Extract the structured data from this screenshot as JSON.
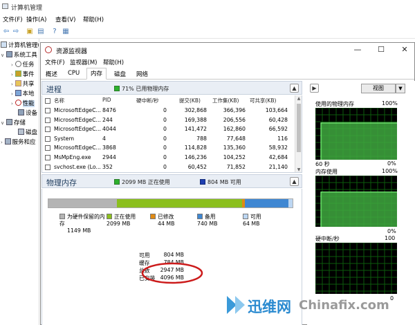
{
  "cm_window": {
    "title": "计算机管理",
    "menu": [
      "文件(F)",
      "操作(A)",
      "查看(V)",
      "帮助(H)"
    ],
    "tree": [
      {
        "label": "计算机管理(",
        "indent": 0
      },
      {
        "label": "系统工具",
        "indent": 1
      },
      {
        "label": "任务",
        "indent": 2
      },
      {
        "label": "事件",
        "indent": 2
      },
      {
        "label": "共享",
        "indent": 2
      },
      {
        "label": "本地",
        "indent": 2
      },
      {
        "label": "性能",
        "indent": 2
      },
      {
        "label": "设备",
        "indent": 2
      },
      {
        "label": "存储",
        "indent": 1
      },
      {
        "label": "磁盘",
        "indent": 2
      },
      {
        "label": "服务和应",
        "indent": 1
      }
    ]
  },
  "rm_window": {
    "title": "资源监视器",
    "menu": [
      "文件(F)",
      "监视器(M)",
      "帮助(H)"
    ],
    "tabs": [
      "概述",
      "CPU",
      "内存",
      "磁盘",
      "网络"
    ],
    "active_tab": "内存",
    "controls": {
      "minimize": "—",
      "maximize": "☐",
      "close": "✕"
    }
  },
  "processes": {
    "title": "进程",
    "status": "71% 已用物理内存",
    "status_color": "#2db02d",
    "columns": [
      "名称",
      "PID",
      "硬中断/秒",
      "提交(KB)",
      "工作集(KB)",
      "可共享(KB)"
    ],
    "rows": [
      [
        "MicrosoftEdgeC...",
        "8476",
        "0",
        "302,868",
        "366,396",
        "103,664"
      ],
      [
        "MicrosoftEdgeC...",
        "244",
        "0",
        "169,388",
        "206,556",
        "60,428"
      ],
      [
        "MicrosoftEdgeC...",
        "4044",
        "0",
        "141,472",
        "162,860",
        "66,592"
      ],
      [
        "System",
        "4",
        "0",
        "788",
        "77,648",
        "116"
      ],
      [
        "MicrosoftEdgeC...",
        "3868",
        "0",
        "114,828",
        "135,360",
        "58,932"
      ],
      [
        "MsMpEng.exe",
        "2944",
        "0",
        "146,236",
        "104,252",
        "42,684"
      ],
      [
        "svchost.exe (Lo...",
        "352",
        "0",
        "60,452",
        "71,852",
        "21,140"
      ]
    ]
  },
  "physical_memory": {
    "title": "物理内存",
    "in_use_label": "2099 MB 正在使用",
    "in_use_color": "#2db02d",
    "available_label": "804 MB 可用",
    "available_color": "#1f3fb0",
    "bar_fractions": {
      "reserved": 0.2805,
      "in_use": 0.5125,
      "modified": 0.0107,
      "standby": 0.1807,
      "free": 0.0156
    },
    "legend": [
      {
        "name": "为硬件保留的内存",
        "value": "1149 MB",
        "color": "#b4b4b4"
      },
      {
        "name": "正在使用",
        "value": "2099 MB",
        "color": "#8bbf1e"
      },
      {
        "name": "已修改",
        "value": "44 MB",
        "color": "#e08a14"
      },
      {
        "name": "备用",
        "value": "740 MB",
        "color": "#3f87d2"
      },
      {
        "name": "可用",
        "value": "64 MB",
        "color": "#bcd6f2"
      }
    ],
    "summary": [
      {
        "k": "可用",
        "v": "804 MB"
      },
      {
        "k": "缓存",
        "v": "784 MB"
      },
      {
        "k": "总数",
        "v": "2947 MB"
      },
      {
        "k": "已安装",
        "v": "4096 MB"
      }
    ],
    "highlight_color": "#cc1b1b"
  },
  "right_panel": {
    "view_label": "视图",
    "graphs": [
      {
        "title": "使用的物理内存",
        "top_value": "100%",
        "bottom_left": "60 秒",
        "bottom_right": "0%",
        "level": 0.71
      },
      {
        "title": "内存使用",
        "top_value": "100%",
        "bottom_left": "",
        "bottom_right": "0%",
        "level": 0.68
      },
      {
        "title": "硬中断/秒",
        "top_value": "100",
        "bottom_left": "",
        "bottom_right": "0",
        "level": 0.0
      }
    ]
  },
  "watermark": {
    "cn": "迅维网",
    "en": "Chinafix.com"
  }
}
